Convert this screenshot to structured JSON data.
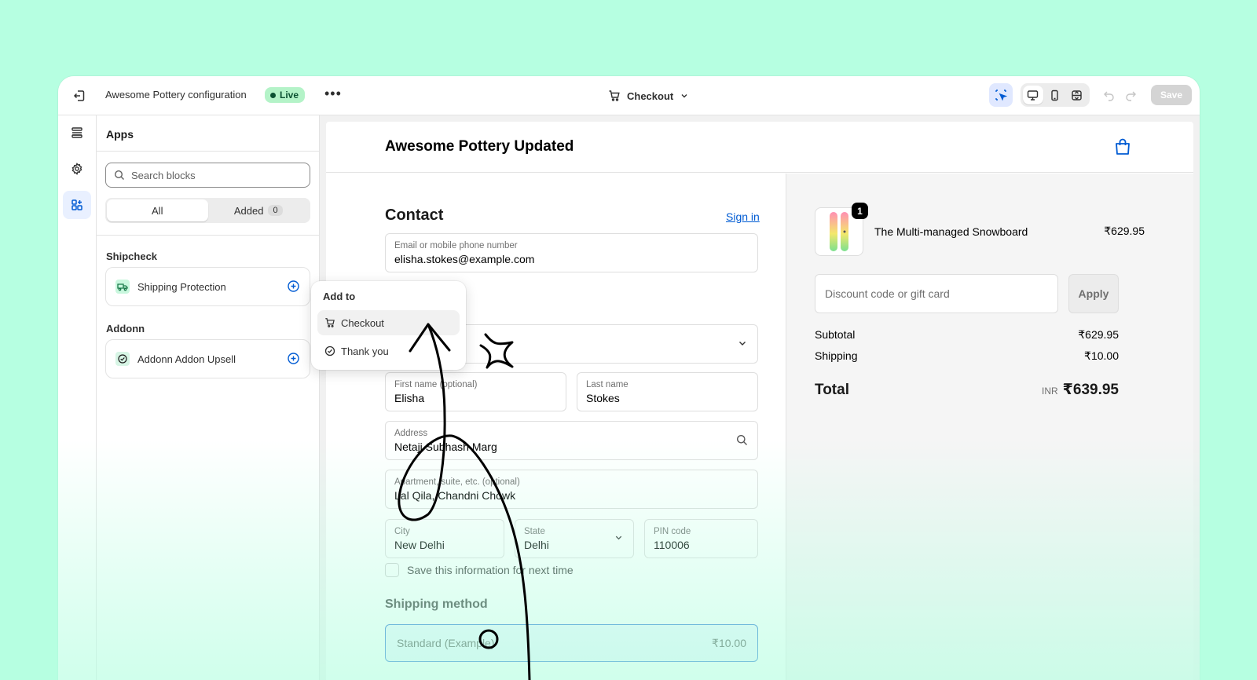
{
  "topbar": {
    "title": "Awesome Pottery configuration",
    "live_label": "Live",
    "page_label": "Checkout",
    "save_label": "Save"
  },
  "panel": {
    "heading": "Apps",
    "search_placeholder": "Search blocks",
    "tabs": {
      "all": "All",
      "added": "Added",
      "added_count": "0"
    },
    "groups": [
      {
        "title": "Shipcheck",
        "block": "Shipping Protection"
      },
      {
        "title": "Addonn",
        "block": "Addonn Addon Upsell"
      }
    ]
  },
  "popover": {
    "title": "Add to",
    "items": [
      "Checkout",
      "Thank you"
    ]
  },
  "store": {
    "name": "Awesome Pottery Updated",
    "contact_heading": "Contact",
    "sign_in": "Sign in",
    "email": {
      "label": "Email or mobile phone number",
      "value": "elisha.stokes@example.com"
    },
    "first_name": {
      "label": "First name (optional)",
      "value": "Elisha"
    },
    "last_name": {
      "label": "Last name",
      "value": "Stokes"
    },
    "address": {
      "label": "Address",
      "value": "Netaji Subhash Marg"
    },
    "apartment": {
      "label": "Apartment, suite, etc. (optional)",
      "value": "Lal Qila, Chandni Chowk"
    },
    "city": {
      "label": "City",
      "value": "New Delhi"
    },
    "state": {
      "label": "State",
      "value": "Delhi"
    },
    "pin": {
      "label": "PIN code",
      "value": "110006"
    },
    "save_info": "Save this information for next time",
    "shipping_heading": "Shipping method",
    "shipping_option": {
      "name": "Standard (Example)",
      "price": "₹10.00"
    }
  },
  "summary": {
    "item_name": "The Multi-managed Snowboard",
    "item_price": "₹629.95",
    "item_qty": "1",
    "discount_placeholder": "Discount code or gift card",
    "apply_label": "Apply",
    "subtotal_label": "Subtotal",
    "subtotal_value": "₹629.95",
    "shipping_label": "Shipping",
    "shipping_value": "₹10.00",
    "total_label": "Total",
    "total_currency": "INR",
    "total_value": "₹639.95"
  },
  "colors": {
    "background": "#b6ffe1",
    "accent": "#005bd3",
    "live": "#b4f3c8"
  }
}
